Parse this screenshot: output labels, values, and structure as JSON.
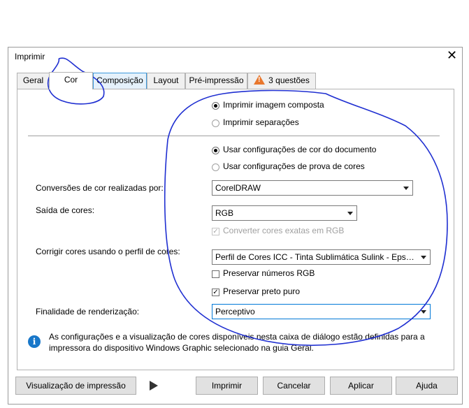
{
  "dialog": {
    "title": "Imprimir",
    "close_icon": "close-icon",
    "tabs": [
      {
        "label": "Geral"
      },
      {
        "label": "Cor"
      },
      {
        "label": "Composição"
      },
      {
        "label": "Layout"
      },
      {
        "label": "Pré-impressão"
      },
      {
        "label": "3 questões",
        "icon": "warning-icon"
      }
    ],
    "active_tab": "Cor"
  },
  "color": {
    "composite_options": [
      {
        "label": "Imprimir imagem composta",
        "selected": true
      },
      {
        "label": "Imprimir separações",
        "selected": false
      }
    ],
    "settings_options": [
      {
        "label": "Usar configurações de cor do documento",
        "selected": true
      },
      {
        "label": "Usar configurações de prova de cores",
        "selected": false
      }
    ],
    "conversion_label": "Conversões de cor realizadas por:",
    "conversion_value": "CorelDRAW",
    "output_label": "Saída de cores:",
    "output_value": "RGB",
    "convert_spot_label": "Converter cores exatas em RGB",
    "correct_label": "Corrigir cores usando o perfil de cores:",
    "correct_value": "Perfil de Cores ICC - Tinta Sublimática Sulink - Epson ...",
    "preserve_rgb_label": "Preservar números RGB",
    "preserve_black_label": "Preservar preto puro",
    "rendering_label": "Finalidade de renderização:",
    "rendering_value": "Perceptivo",
    "info_icon": "info-icon",
    "info_line1": "As configurações e a visualização de cores disponíveis nesta caixa de diálogo estão definidas para a",
    "info_line2": "impressora do dispositivo Windows Graphic selecionado na guia Geral."
  },
  "footer": {
    "preview_label": "Visualização de impressão",
    "preview_arrow_icon": "play-icon",
    "print_label": "Imprimir",
    "cancel_label": "Cancelar",
    "apply_label": "Aplicar",
    "help_label": "Ajuda"
  },
  "colors": {
    "accent": "#0078d7",
    "warning": "#e8772e",
    "info": "#1877c9",
    "annotation_ink": "#1f2fd1"
  }
}
